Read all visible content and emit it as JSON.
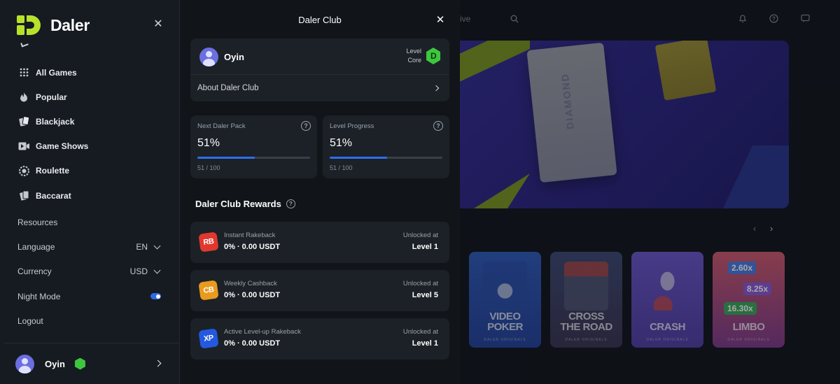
{
  "brand": {
    "name": "Daler",
    "accent": "#b7e22b"
  },
  "topbar": {
    "live_label": "ive"
  },
  "sidebar": {
    "games": [
      {
        "label": "All Games",
        "icon": "grid-icon"
      },
      {
        "label": "Popular",
        "icon": "flame-icon"
      },
      {
        "label": "Blackjack",
        "icon": "cards-icon"
      },
      {
        "label": "Game Shows",
        "icon": "play-icon"
      },
      {
        "label": "Roulette",
        "icon": "roulette-icon"
      },
      {
        "label": "Baccarat",
        "icon": "baccarat-icon"
      }
    ],
    "resources_label": "Resources",
    "language_label": "Language",
    "language_value": "EN",
    "currency_label": "Currency",
    "currency_value": "USD",
    "night_mode_label": "Night Mode",
    "night_mode_on": true,
    "logout_label": "Logout",
    "user_name": "Oyin"
  },
  "club": {
    "title": "Daler Club",
    "user_name": "Oyin",
    "level_label": "Level",
    "level_value": "Core",
    "about_label": "About Daler Club",
    "next_pack": {
      "label": "Next Daler Pack",
      "percent": "51%",
      "progress": 0.51,
      "count": "51 / 100"
    },
    "level_progress": {
      "label": "Level Progress",
      "percent": "51%",
      "progress": 0.51,
      "count": "51 / 100"
    },
    "rewards_title": "Daler Club Rewards",
    "rewards": [
      {
        "badge": "RB",
        "name": "Instant Rakeback",
        "value": "0% · 0.00 USDT",
        "unlock_label": "Unlocked at",
        "level": "Level 1",
        "color": "#e0382e"
      },
      {
        "badge": "CB",
        "name": "Weekly Cashback",
        "value": "0% · 0.00 USDT",
        "unlock_label": "Unlocked at",
        "level": "Level 5",
        "color": "#e89b1e"
      },
      {
        "badge": "XP",
        "name": "Active Level-up Rakeback",
        "value": "0% · 0.00 USDT",
        "unlock_label": "Unlocked at",
        "level": "Level 1",
        "color": "#2458e0"
      }
    ]
  },
  "games": [
    {
      "line1": "VIDEO",
      "line2": "POKER",
      "sub": "DALER ORIGINALS"
    },
    {
      "line1": "CROSS",
      "line2": "THE ROAD",
      "sub": "DALER ORIGINALS"
    },
    {
      "line1": "",
      "line2": "CRASH",
      "sub": "DALER ORIGINALS"
    },
    {
      "line1": "",
      "line2": "LIMBO",
      "sub": "DALER ORIGINALS"
    }
  ],
  "limbo_chips": [
    "2.60x",
    "8.25x",
    "16.30x"
  ]
}
